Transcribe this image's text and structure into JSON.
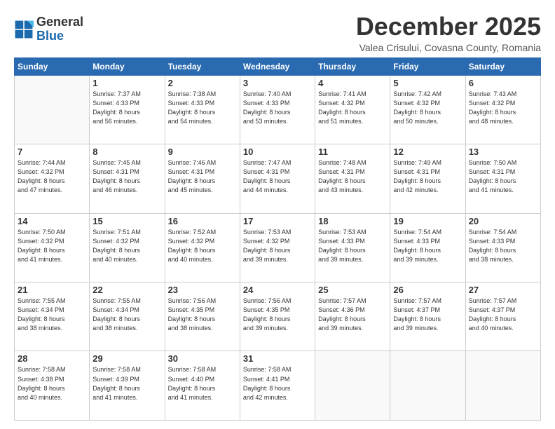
{
  "header": {
    "logo_general": "General",
    "logo_blue": "Blue",
    "title": "December 2025",
    "location": "Valea Crisului, Covasna County, Romania"
  },
  "weekdays": [
    "Sunday",
    "Monday",
    "Tuesday",
    "Wednesday",
    "Thursday",
    "Friday",
    "Saturday"
  ],
  "weeks": [
    [
      {
        "day": "",
        "sunrise": "",
        "sunset": "",
        "daylight": ""
      },
      {
        "day": "1",
        "sunrise": "Sunrise: 7:37 AM",
        "sunset": "Sunset: 4:33 PM",
        "daylight": "Daylight: 8 hours and 56 minutes."
      },
      {
        "day": "2",
        "sunrise": "Sunrise: 7:38 AM",
        "sunset": "Sunset: 4:33 PM",
        "daylight": "Daylight: 8 hours and 54 minutes."
      },
      {
        "day": "3",
        "sunrise": "Sunrise: 7:40 AM",
        "sunset": "Sunset: 4:33 PM",
        "daylight": "Daylight: 8 hours and 53 minutes."
      },
      {
        "day": "4",
        "sunrise": "Sunrise: 7:41 AM",
        "sunset": "Sunset: 4:32 PM",
        "daylight": "Daylight: 8 hours and 51 minutes."
      },
      {
        "day": "5",
        "sunrise": "Sunrise: 7:42 AM",
        "sunset": "Sunset: 4:32 PM",
        "daylight": "Daylight: 8 hours and 50 minutes."
      },
      {
        "day": "6",
        "sunrise": "Sunrise: 7:43 AM",
        "sunset": "Sunset: 4:32 PM",
        "daylight": "Daylight: 8 hours and 48 minutes."
      }
    ],
    [
      {
        "day": "7",
        "sunrise": "Sunrise: 7:44 AM",
        "sunset": "Sunset: 4:32 PM",
        "daylight": "Daylight: 8 hours and 47 minutes."
      },
      {
        "day": "8",
        "sunrise": "Sunrise: 7:45 AM",
        "sunset": "Sunset: 4:31 PM",
        "daylight": "Daylight: 8 hours and 46 minutes."
      },
      {
        "day": "9",
        "sunrise": "Sunrise: 7:46 AM",
        "sunset": "Sunset: 4:31 PM",
        "daylight": "Daylight: 8 hours and 45 minutes."
      },
      {
        "day": "10",
        "sunrise": "Sunrise: 7:47 AM",
        "sunset": "Sunset: 4:31 PM",
        "daylight": "Daylight: 8 hours and 44 minutes."
      },
      {
        "day": "11",
        "sunrise": "Sunrise: 7:48 AM",
        "sunset": "Sunset: 4:31 PM",
        "daylight": "Daylight: 8 hours and 43 minutes."
      },
      {
        "day": "12",
        "sunrise": "Sunrise: 7:49 AM",
        "sunset": "Sunset: 4:31 PM",
        "daylight": "Daylight: 8 hours and 42 minutes."
      },
      {
        "day": "13",
        "sunrise": "Sunrise: 7:50 AM",
        "sunset": "Sunset: 4:31 PM",
        "daylight": "Daylight: 8 hours and 41 minutes."
      }
    ],
    [
      {
        "day": "14",
        "sunrise": "Sunrise: 7:50 AM",
        "sunset": "Sunset: 4:32 PM",
        "daylight": "Daylight: 8 hours and 41 minutes."
      },
      {
        "day": "15",
        "sunrise": "Sunrise: 7:51 AM",
        "sunset": "Sunset: 4:32 PM",
        "daylight": "Daylight: 8 hours and 40 minutes."
      },
      {
        "day": "16",
        "sunrise": "Sunrise: 7:52 AM",
        "sunset": "Sunset: 4:32 PM",
        "daylight": "Daylight: 8 hours and 40 minutes."
      },
      {
        "day": "17",
        "sunrise": "Sunrise: 7:53 AM",
        "sunset": "Sunset: 4:32 PM",
        "daylight": "Daylight: 8 hours and 39 minutes."
      },
      {
        "day": "18",
        "sunrise": "Sunrise: 7:53 AM",
        "sunset": "Sunset: 4:33 PM",
        "daylight": "Daylight: 8 hours and 39 minutes."
      },
      {
        "day": "19",
        "sunrise": "Sunrise: 7:54 AM",
        "sunset": "Sunset: 4:33 PM",
        "daylight": "Daylight: 8 hours and 39 minutes."
      },
      {
        "day": "20",
        "sunrise": "Sunrise: 7:54 AM",
        "sunset": "Sunset: 4:33 PM",
        "daylight": "Daylight: 8 hours and 38 minutes."
      }
    ],
    [
      {
        "day": "21",
        "sunrise": "Sunrise: 7:55 AM",
        "sunset": "Sunset: 4:34 PM",
        "daylight": "Daylight: 8 hours and 38 minutes."
      },
      {
        "day": "22",
        "sunrise": "Sunrise: 7:55 AM",
        "sunset": "Sunset: 4:34 PM",
        "daylight": "Daylight: 8 hours and 38 minutes."
      },
      {
        "day": "23",
        "sunrise": "Sunrise: 7:56 AM",
        "sunset": "Sunset: 4:35 PM",
        "daylight": "Daylight: 8 hours and 38 minutes."
      },
      {
        "day": "24",
        "sunrise": "Sunrise: 7:56 AM",
        "sunset": "Sunset: 4:35 PM",
        "daylight": "Daylight: 8 hours and 39 minutes."
      },
      {
        "day": "25",
        "sunrise": "Sunrise: 7:57 AM",
        "sunset": "Sunset: 4:36 PM",
        "daylight": "Daylight: 8 hours and 39 minutes."
      },
      {
        "day": "26",
        "sunrise": "Sunrise: 7:57 AM",
        "sunset": "Sunset: 4:37 PM",
        "daylight": "Daylight: 8 hours and 39 minutes."
      },
      {
        "day": "27",
        "sunrise": "Sunrise: 7:57 AM",
        "sunset": "Sunset: 4:37 PM",
        "daylight": "Daylight: 8 hours and 40 minutes."
      }
    ],
    [
      {
        "day": "28",
        "sunrise": "Sunrise: 7:58 AM",
        "sunset": "Sunset: 4:38 PM",
        "daylight": "Daylight: 8 hours and 40 minutes."
      },
      {
        "day": "29",
        "sunrise": "Sunrise: 7:58 AM",
        "sunset": "Sunset: 4:39 PM",
        "daylight": "Daylight: 8 hours and 41 minutes."
      },
      {
        "day": "30",
        "sunrise": "Sunrise: 7:58 AM",
        "sunset": "Sunset: 4:40 PM",
        "daylight": "Daylight: 8 hours and 41 minutes."
      },
      {
        "day": "31",
        "sunrise": "Sunrise: 7:58 AM",
        "sunset": "Sunset: 4:41 PM",
        "daylight": "Daylight: 8 hours and 42 minutes."
      },
      {
        "day": "",
        "sunrise": "",
        "sunset": "",
        "daylight": ""
      },
      {
        "day": "",
        "sunrise": "",
        "sunset": "",
        "daylight": ""
      },
      {
        "day": "",
        "sunrise": "",
        "sunset": "",
        "daylight": ""
      }
    ]
  ]
}
